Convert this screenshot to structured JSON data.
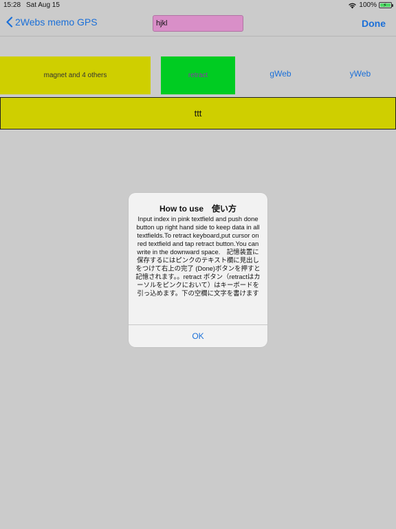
{
  "status_bar": {
    "time": "15:28",
    "date": "Sat Aug 15",
    "battery_percent": "100%",
    "icons": [
      "wifi-icon",
      "battery-charging-icon"
    ]
  },
  "nav": {
    "back_label": "2Webs memo GPS",
    "back_icon": "chevron-left-icon",
    "title_input_value": "hjkl",
    "done_label": "Done"
  },
  "toolbar": {
    "magnet_label": "magnet and 4 others",
    "retract_label": "retract",
    "gweb_label": "gWeb",
    "yweb_label": "yWeb"
  },
  "main_field": {
    "value": "ttt"
  },
  "alert": {
    "title": "How to use　使い方",
    "message": "Input index  in pink textfield and push done button  up right hand side to keep data in all textfields.To retract keyboard,put cursor on red textfield and tap retract button.You can write in the downward space.　記憶装置に保存するにはピンクのテキスト欄に見出しをつけて右上の完了 (Done)ボタンを押すと記憶されます。。retract ボタン（retractはカーソルをピンクにおいて）はキーボードを引っ込めます。下の空欄に文字を書けます",
    "ok_label": "OK"
  },
  "colors": {
    "background": "#cbcbcb",
    "accent_blue": "#1a6fd8",
    "title_input_pink": "#d98fc8",
    "yellow_field": "#cfcf00",
    "retract_green": "#00cc22",
    "retract_text": "#8a3aa8",
    "battery_green": "#4cd964"
  }
}
